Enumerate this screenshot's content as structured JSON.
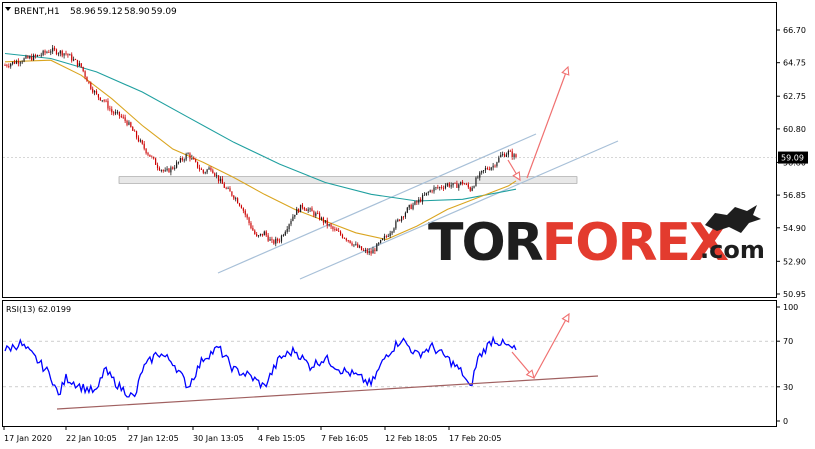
{
  "chart_data": {
    "type": "candlestick",
    "symbol_header": "BRENT,H1",
    "ohlc_readout": [
      "58.96",
      "59.12",
      "58.90",
      "59.09"
    ],
    "current_price": "59.09",
    "price_axis": {
      "ticks": [
        "66.70",
        "64.75",
        "62.75",
        "60.80",
        "58.80",
        "56.85",
        "54.90",
        "52.90",
        "50.95"
      ],
      "ylim": [
        50.95,
        66.7
      ]
    },
    "time_axis": {
      "ticks": [
        "17 Jan 2020",
        "22 Jan 10:05",
        "27 Jan 12:05",
        "30 Jan 13:05",
        "4 Feb 15:05",
        "7 Feb 16:05",
        "12 Feb 18:05",
        "17 Feb 20:05"
      ]
    },
    "price_path": {
      "description_points": [
        [
          0,
          64.6
        ],
        [
          2,
          64.9
        ],
        [
          4,
          65.1
        ],
        [
          6,
          65.5
        ],
        [
          8,
          65.3
        ],
        [
          10,
          64.5
        ],
        [
          11,
          63.5
        ],
        [
          12,
          62.8
        ],
        [
          13,
          62.5
        ],
        [
          14,
          61.8
        ],
        [
          15,
          61.6
        ],
        [
          16,
          61.2
        ],
        [
          17,
          60.5
        ],
        [
          18,
          59.8
        ],
        [
          19,
          59.2
        ],
        [
          20,
          58.6
        ],
        [
          21,
          58.2
        ],
        [
          22,
          58.5
        ],
        [
          23,
          58.9
        ],
        [
          24,
          59.3
        ],
        [
          25,
          58.7
        ],
        [
          26,
          58.2
        ],
        [
          27,
          58.5
        ],
        [
          28,
          57.8
        ],
        [
          29,
          57.2
        ],
        [
          30,
          56.8
        ],
        [
          31,
          56.2
        ],
        [
          32,
          55.2
        ],
        [
          33,
          54.3
        ],
        [
          34,
          54.6
        ],
        [
          35,
          54.0
        ],
        [
          36,
          54.2
        ],
        [
          37,
          55.0
        ],
        [
          38,
          55.8
        ],
        [
          39,
          56.2
        ],
        [
          40,
          55.9
        ],
        [
          41,
          55.6
        ],
        [
          42,
          55.2
        ],
        [
          43,
          54.8
        ],
        [
          44,
          54.5
        ],
        [
          45,
          54.2
        ],
        [
          46,
          53.8
        ],
        [
          47,
          53.5
        ],
        [
          48,
          53.4
        ],
        [
          49,
          53.9
        ],
        [
          50,
          54.4
        ],
        [
          51,
          55.0
        ],
        [
          52,
          55.6
        ],
        [
          53,
          56.1
        ],
        [
          54,
          56.4
        ],
        [
          55,
          56.8
        ],
        [
          56,
          57.2
        ],
        [
          57,
          57.3
        ],
        [
          58,
          57.5
        ],
        [
          59,
          57.4
        ],
        [
          60,
          57.6
        ],
        [
          61,
          57.2
        ],
        [
          62,
          57.9
        ],
        [
          63,
          58.4
        ],
        [
          64,
          58.6
        ],
        [
          65,
          59.2
        ],
        [
          66,
          59.4
        ],
        [
          67,
          59.1
        ]
      ],
      "bars_total": 68
    },
    "ma_fast_path": [
      [
        0,
        64.8
      ],
      [
        6,
        64.9
      ],
      [
        10,
        64.0
      ],
      [
        14,
        62.6
      ],
      [
        18,
        61.0
      ],
      [
        22,
        59.6
      ],
      [
        26,
        58.8
      ],
      [
        30,
        57.9
      ],
      [
        34,
        56.9
      ],
      [
        38,
        56.0
      ],
      [
        42,
        55.3
      ],
      [
        46,
        54.6
      ],
      [
        50,
        54.2
      ],
      [
        54,
        55.0
      ],
      [
        58,
        56.0
      ],
      [
        62,
        56.7
      ],
      [
        66,
        57.4
      ],
      [
        67,
        57.7
      ]
    ],
    "ma_slow_path": [
      [
        0,
        65.3
      ],
      [
        6,
        65.0
      ],
      [
        12,
        64.2
      ],
      [
        18,
        63.0
      ],
      [
        24,
        61.5
      ],
      [
        30,
        60.0
      ],
      [
        36,
        58.7
      ],
      [
        42,
        57.6
      ],
      [
        48,
        56.9
      ],
      [
        54,
        56.5
      ],
      [
        60,
        56.6
      ],
      [
        67,
        57.2
      ]
    ],
    "support_zone": [
      57.55,
      57.95
    ],
    "rsi": {
      "label": "RSI(13) 62.0199",
      "ticks": [
        "100",
        "70",
        "30",
        "0"
      ],
      "ylim": [
        0,
        100
      ],
      "path": [
        [
          0,
          62
        ],
        [
          2,
          68
        ],
        [
          4,
          55
        ],
        [
          6,
          40
        ],
        [
          7,
          22
        ],
        [
          8,
          38
        ],
        [
          10,
          30
        ],
        [
          12,
          25
        ],
        [
          13,
          45
        ],
        [
          15,
          30
        ],
        [
          17,
          20
        ],
        [
          18,
          45
        ],
        [
          20,
          60
        ],
        [
          22,
          52
        ],
        [
          24,
          30
        ],
        [
          26,
          55
        ],
        [
          28,
          64
        ],
        [
          30,
          45
        ],
        [
          32,
          40
        ],
        [
          34,
          30
        ],
        [
          36,
          55
        ],
        [
          38,
          62
        ],
        [
          40,
          48
        ],
        [
          42,
          55
        ],
        [
          44,
          45
        ],
        [
          46,
          40
        ],
        [
          48,
          32
        ],
        [
          50,
          58
        ],
        [
          52,
          72
        ],
        [
          54,
          58
        ],
        [
          56,
          65
        ],
        [
          58,
          55
        ],
        [
          60,
          42
        ],
        [
          61,
          28
        ],
        [
          62,
          55
        ],
        [
          64,
          72
        ],
        [
          66,
          65
        ],
        [
          67,
          62
        ]
      ]
    }
  },
  "watermark": {
    "brand_left": "TOR",
    "brand_mid": "FOREX",
    "brand_right": ".com"
  },
  "colors": {
    "bull": "#1a1a1a",
    "bear": "#cc0000",
    "ma_fast": "#daa520",
    "ma_slow": "#20a0a0",
    "channel": "#a8c0d8",
    "zone": "#e8e8e8",
    "arrow": "#f07070",
    "rsi_line": "#0000ff",
    "rsi_support": "#a06060",
    "brand_dark": "#1e1e1e",
    "brand_red": "#e33b2e"
  }
}
